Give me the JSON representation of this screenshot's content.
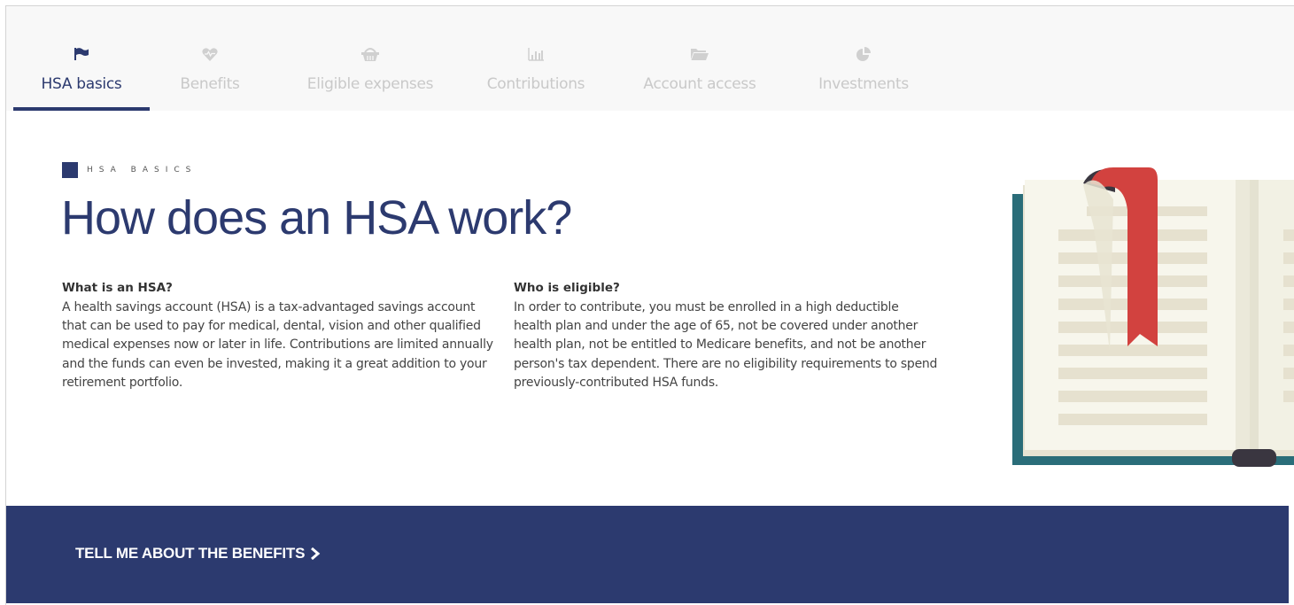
{
  "tabs": [
    {
      "label": "HSA basics",
      "icon": "flag-icon",
      "active": true
    },
    {
      "label": "Benefits",
      "icon": "heart-icon",
      "active": false
    },
    {
      "label": "Eligible expenses",
      "icon": "basket-icon",
      "active": false
    },
    {
      "label": "Contributions",
      "icon": "bar-chart-icon",
      "active": false
    },
    {
      "label": "Account access",
      "icon": "folder-icon",
      "active": false
    },
    {
      "label": "Investments",
      "icon": "pie-chart-icon",
      "active": false
    }
  ],
  "section": {
    "eyebrow": "HSA BASICS",
    "title": "How does an HSA work?"
  },
  "columns": [
    {
      "heading": "What is an HSA?",
      "body": "A health savings account (HSA) is a tax-advantaged savings account that can be used to pay for medical, dental, vision and other qualified medical expenses now or later in life. Contributions are limited annually and the funds can even be invested, making it a great addition to your retirement portfolio."
    },
    {
      "heading": "Who is eligible?",
      "body": "In order to contribute, you must be enrolled in a high deductible health plan and under the age of 65, not be covered under another health plan, not be entitled to Medicare benefits, and not be another person's tax dependent. There are no eligibility requirements to spend previously-contributed HSA funds."
    }
  ],
  "banner": {
    "cta_label": "TELL ME ABOUT THE BENEFITS"
  },
  "colors": {
    "brand_navy": "#2c3a6f",
    "tab_inactive": "#c9c9c9",
    "bookmark_red": "#d2423f",
    "book_cover": "#2a6d79"
  }
}
